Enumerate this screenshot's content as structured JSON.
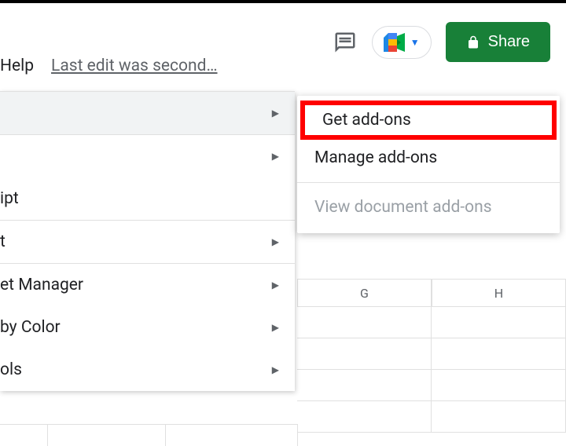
{
  "header": {
    "share_label": "Share"
  },
  "menubar": {
    "help_label": "Help",
    "last_edit_text": "Last edit was second…"
  },
  "menu": {
    "items": [
      "",
      "",
      "ipt",
      "t",
      "et Manager",
      "by Color",
      "ols"
    ]
  },
  "submenu": {
    "get_addons": "Get add-ons",
    "manage_addons": "Manage add-ons",
    "view_doc_addons": "View document add-ons"
  },
  "grid": {
    "columns": [
      "G",
      "H"
    ]
  }
}
